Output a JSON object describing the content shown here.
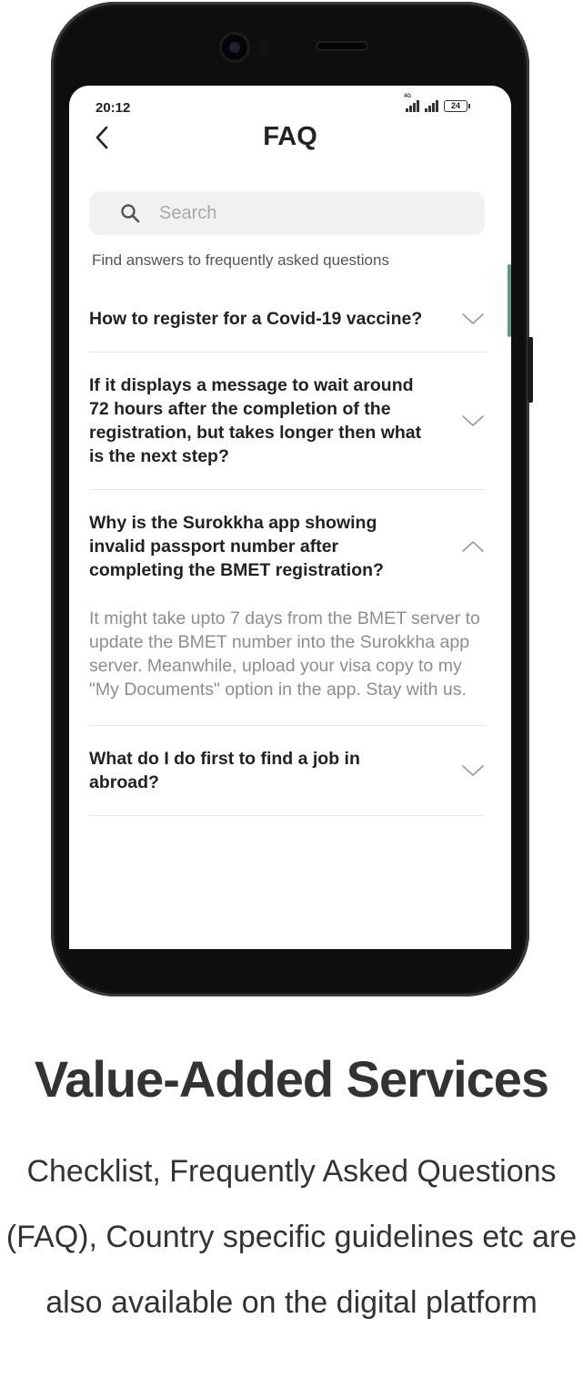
{
  "status_bar": {
    "time": "20:12",
    "network": "4G",
    "battery": "24"
  },
  "header": {
    "title": "FAQ"
  },
  "search": {
    "placeholder": "Search"
  },
  "subtitle": "Find answers to frequently asked questions",
  "faq": [
    {
      "question": "How to register for a Covid-19 vaccine?",
      "expanded": false
    },
    {
      "question": "If it displays a message to wait around 72 hours after the completion of the registration, but takes longer then what is the next step?",
      "expanded": false
    },
    {
      "question": "Why is the Surokkha app showing invalid passport number after completing the BMET registration?",
      "answer": "It might take upto 7 days from the BMET server to update the BMET number into the Surokkha app server. Meanwhile, upload your visa copy to my \"My Documents\" option in the app. Stay with us.",
      "expanded": true
    },
    {
      "question": "What do I do first to find a job in abroad?",
      "expanded": false
    }
  ],
  "promo": {
    "heading": "Value-Added Services",
    "description": "Checklist, Frequently Asked Questions (FAQ), Country specific guidelines etc are also available on the digital platform"
  }
}
